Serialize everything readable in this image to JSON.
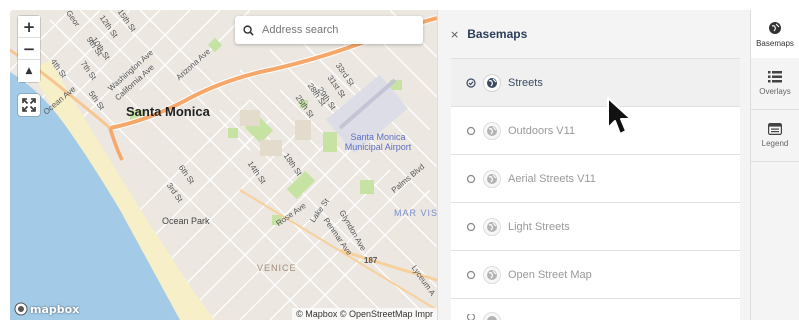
{
  "map": {
    "zoom_in_label": "+",
    "zoom_out_label": "−",
    "compass_label": "▲",
    "search": {
      "placeholder": "Address search"
    },
    "labels": {
      "city": "Santa Monica",
      "ocean_park": "Ocean Park",
      "venice": "VENICE",
      "airport": "Santa Monica Municipal Airport",
      "mar_vista": "MAR VIS",
      "ocean_ave": "Ocean Ave",
      "arizona_ave": "Arizona Ave",
      "washington_ave": "Washington Ave",
      "california_ave": "California Ave",
      "fourth_st": "4th St",
      "seventh_st": "7th St",
      "ninth_st": "9th St",
      "fifth_st": "5th St",
      "tenth_st": "10th St",
      "twelfth_st": "12th St",
      "fifteenth_st": "15th St",
      "georgina": "Geor",
      "third_st": "3rd St",
      "sixth_st": "6th St",
      "fourteenth_st": "14th St",
      "eighteenth_st": "18th St",
      "twentyfifth_st": "25th St",
      "twentyeighth_st": "28th St",
      "thirtythird_st": "33rd St",
      "thirtyfirst_st": "31st St",
      "twentyninth_st": "29th St",
      "palms_blvd": "Palms Blvd",
      "rose_ave": "Rose Ave",
      "lake_st": "Lake St",
      "penmar_ave": "Penmar Ave",
      "glyndon_ave": "Glyndon Ave",
      "lyceum_ave": "Lyceum A",
      "route_187": "187"
    },
    "mapbox_text": "mapbox",
    "attribution": "© Mapbox © OpenStreetMap Impr"
  },
  "panel": {
    "close_label": "×",
    "title": "Basemaps",
    "basemaps": [
      {
        "label": "Streets",
        "selected": true
      },
      {
        "label": "Outdoors V11",
        "selected": false
      },
      {
        "label": "Aerial Streets V11",
        "selected": false
      },
      {
        "label": "Light Streets",
        "selected": false
      },
      {
        "label": "Open Street Map",
        "selected": false
      }
    ]
  },
  "tabs": [
    {
      "label": "Basemaps",
      "icon": "globe-icon",
      "active": true
    },
    {
      "label": "Overlays",
      "icon": "list-icon",
      "active": false
    },
    {
      "label": "Legend",
      "icon": "legend-icon",
      "active": false
    }
  ],
  "colors": {
    "water": "#a3cbe8",
    "land": "#ece7e0",
    "park": "#c6e3a3",
    "highway": "#f5a86a",
    "panel_bg": "#f4f4f4",
    "title": "#2c3e5a"
  }
}
